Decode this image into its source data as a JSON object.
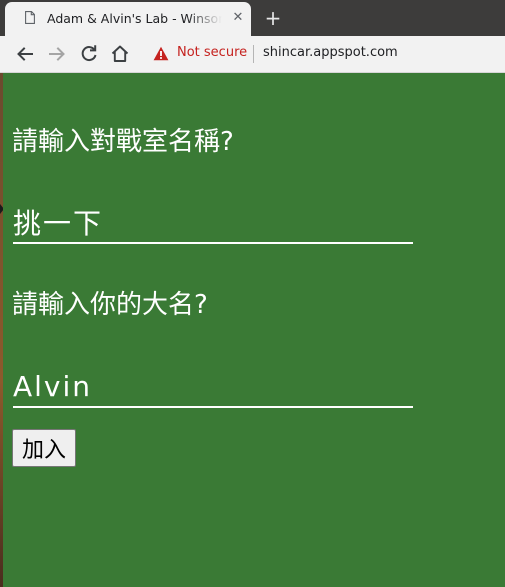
{
  "browser": {
    "tab_title": "Adam & Alvin's Lab - Winsome",
    "tab_close": "✕",
    "new_tab": "+",
    "security_label": "Not secure",
    "url": "shincar.appspot.com"
  },
  "form": {
    "room_prompt": "請輸入對戰室名稱?",
    "room_value": "挑一下",
    "name_prompt": "請輸入你的大名?",
    "name_value": "Alvin",
    "join_label": "加入"
  },
  "colors": {
    "page_background": "#3a7a35",
    "text": "#ffffff",
    "warning": "#c5221f"
  },
  "icons": [
    "page-icon",
    "back-arrow-icon",
    "forward-arrow-icon",
    "reload-icon",
    "home-icon",
    "warning-icon"
  ]
}
